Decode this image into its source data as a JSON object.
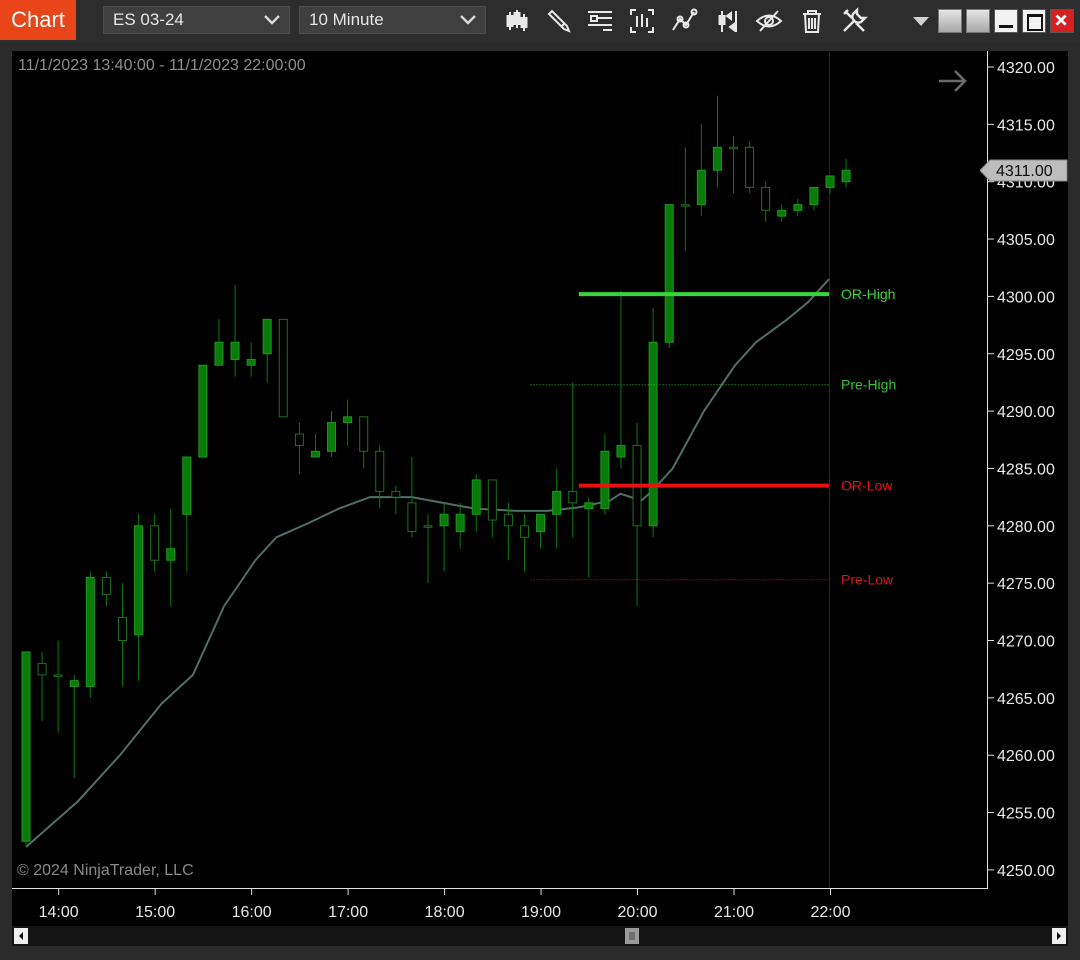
{
  "window": {
    "tab_label": "Chart",
    "instrument": "ES 03-24",
    "interval": "10 Minute"
  },
  "toolbar": {
    "icons": [
      "bar-type-icon",
      "drawing-tool-icon",
      "drawing-objects-icon",
      "data-box-icon",
      "indicators-icon",
      "strategies-icon",
      "show-hide-icon",
      "delete-icon",
      "properties-icon"
    ],
    "window_buttons": [
      "menu-dropdown-icon",
      "window-tile-1-icon",
      "window-tile-2-icon",
      "minimize-icon",
      "maximize-icon",
      "close-icon"
    ]
  },
  "chart_header": {
    "date_range": "11/1/2023 13:40:00 - 11/1/2023 22:00:00"
  },
  "footer": {
    "copyright": "© 2024 NinjaTrader, LLC"
  },
  "colors": {
    "candle_up": "#0a7a0a",
    "candle_up_body_border": "#1a9a1a",
    "candle_doji": "#1f6f1f",
    "moving_average": "#4f6f6a",
    "or_high": "#38d638",
    "or_low": "#e81010",
    "pre_high": "#38c238",
    "pre_low": "#d01818",
    "accent": "#e8461a"
  },
  "chart_data": {
    "type": "candlestick",
    "title": "",
    "xlabel": "",
    "ylabel": "",
    "ylim": [
      4248.5,
      4321.5
    ],
    "yticks": [
      "4320.00",
      "4315.00",
      "4310.00",
      "4305.00",
      "4300.00",
      "4295.00",
      "4290.00",
      "4285.00",
      "4280.00",
      "4275.00",
      "4270.00",
      "4265.00",
      "4260.00",
      "4255.00",
      "4250.00"
    ],
    "xticks": [
      "14:00",
      "15:00",
      "16:00",
      "17:00",
      "18:00",
      "19:00",
      "20:00",
      "21:00",
      "22:00"
    ],
    "last_price": "4311.00",
    "candles": [
      {
        "t": "13:40",
        "o": 4252.5,
        "h": 4269.0,
        "l": 4252.0,
        "c": 4269.0
      },
      {
        "t": "13:50",
        "o": 4268.0,
        "h": 4269.0,
        "l": 4263.0,
        "c": 4267.0
      },
      {
        "t": "14:00",
        "o": 4267.0,
        "h": 4270.0,
        "l": 4262.0,
        "c": 4267.0
      },
      {
        "t": "14:10",
        "o": 4266.0,
        "h": 4267.0,
        "l": 4258.0,
        "c": 4266.5
      },
      {
        "t": "14:20",
        "o": 4266.0,
        "h": 4276.0,
        "l": 4265.0,
        "c": 4275.5
      },
      {
        "t": "14:30",
        "o": 4275.5,
        "h": 4276.0,
        "l": 4273.0,
        "c": 4274.0
      },
      {
        "t": "14:40",
        "o": 4272.0,
        "h": 4275.0,
        "l": 4266.0,
        "c": 4270.0
      },
      {
        "t": "14:50",
        "o": 4270.5,
        "h": 4281.0,
        "l": 4266.5,
        "c": 4280.0
      },
      {
        "t": "15:00",
        "o": 4280.0,
        "h": 4281.0,
        "l": 4276.0,
        "c": 4277.0
      },
      {
        "t": "15:10",
        "o": 4277.0,
        "h": 4281.5,
        "l": 4273.0,
        "c": 4278.0
      },
      {
        "t": "15:20",
        "o": 4281.0,
        "h": 4286.0,
        "l": 4276.0,
        "c": 4286.0
      },
      {
        "t": "15:30",
        "o": 4286.0,
        "h": 4294.0,
        "l": 4286.0,
        "c": 4294.0
      },
      {
        "t": "15:40",
        "o": 4294.0,
        "h": 4298.0,
        "l": 4294.0,
        "c": 4296.0
      },
      {
        "t": "15:50",
        "o": 4294.5,
        "h": 4301.0,
        "l": 4293.0,
        "c": 4296.0
      },
      {
        "t": "16:00",
        "o": 4294.0,
        "h": 4296.0,
        "l": 4293.0,
        "c": 4294.5
      },
      {
        "t": "16:10",
        "o": 4295.0,
        "h": 4298.0,
        "l": 4292.5,
        "c": 4298.0
      },
      {
        "t": "16:20",
        "o": 4298.0,
        "h": 4298.0,
        "l": 4289.5,
        "c": 4289.5
      },
      {
        "t": "16:30",
        "o": 4288.0,
        "h": 4289.0,
        "l": 4284.5,
        "c": 4287.0
      },
      {
        "t": "16:40",
        "o": 4286.0,
        "h": 4288.0,
        "l": 4286.0,
        "c": 4286.5
      },
      {
        "t": "16:50",
        "o": 4286.5,
        "h": 4290.0,
        "l": 4286.0,
        "c": 4289.0
      },
      {
        "t": "17:00",
        "o": 4289.0,
        "h": 4291.0,
        "l": 4287.0,
        "c": 4289.5
      },
      {
        "t": "17:10",
        "o": 4289.5,
        "h": 4289.5,
        "l": 4285.0,
        "c": 4286.5
      },
      {
        "t": "17:20",
        "o": 4286.5,
        "h": 4287.0,
        "l": 4281.5,
        "c": 4283.0
      },
      {
        "t": "17:30",
        "o": 4283.0,
        "h": 4283.5,
        "l": 4281.0,
        "c": 4282.5
      },
      {
        "t": "17:40",
        "o": 4282.0,
        "h": 4286.0,
        "l": 4279.0,
        "c": 4279.5
      },
      {
        "t": "17:50",
        "o": 4280.0,
        "h": 4281.0,
        "l": 4275.0,
        "c": 4280.0
      },
      {
        "t": "18:00",
        "o": 4280.0,
        "h": 4282.0,
        "l": 4276.0,
        "c": 4281.0
      },
      {
        "t": "18:10",
        "o": 4279.5,
        "h": 4282.0,
        "l": 4278.0,
        "c": 4281.0
      },
      {
        "t": "18:20",
        "o": 4281.0,
        "h": 4284.5,
        "l": 4279.5,
        "c": 4284.0
      },
      {
        "t": "18:30",
        "o": 4284.0,
        "h": 4284.0,
        "l": 4279.0,
        "c": 4280.5
      },
      {
        "t": "18:40",
        "o": 4281.0,
        "h": 4282.0,
        "l": 4277.0,
        "c": 4280.0
      },
      {
        "t": "18:50",
        "o": 4280.0,
        "h": 4281.0,
        "l": 4276.0,
        "c": 4279.0
      },
      {
        "t": "19:00",
        "o": 4279.5,
        "h": 4281.0,
        "l": 4278.0,
        "c": 4281.0
      },
      {
        "t": "19:10",
        "o": 4281.0,
        "h": 4285.0,
        "l": 4278.0,
        "c": 4283.0
      },
      {
        "t": "19:20",
        "o": 4283.0,
        "h": 4292.5,
        "l": 4279.0,
        "c": 4282.0
      },
      {
        "t": "19:30",
        "o": 4281.5,
        "h": 4282.5,
        "l": 4275.5,
        "c": 4282.0
      },
      {
        "t": "19:40",
        "o": 4281.5,
        "h": 4288.0,
        "l": 4281.0,
        "c": 4286.5
      },
      {
        "t": "19:50",
        "o": 4286.0,
        "h": 4300.5,
        "l": 4285.0,
        "c": 4287.0
      },
      {
        "t": "20:00",
        "o": 4287.0,
        "h": 4289.0,
        "l": 4273.0,
        "c": 4280.0
      },
      {
        "t": "20:10",
        "o": 4280.0,
        "h": 4299.0,
        "l": 4279.0,
        "c": 4296.0
      },
      {
        "t": "20:20",
        "o": 4296.0,
        "h": 4308.0,
        "l": 4295.5,
        "c": 4308.0
      },
      {
        "t": "20:30",
        "o": 4308.0,
        "h": 4313.0,
        "l": 4304.0,
        "c": 4308.0
      },
      {
        "t": "20:40",
        "o": 4308.0,
        "h": 4315.0,
        "l": 4307.0,
        "c": 4311.0
      },
      {
        "t": "20:50",
        "o": 4311.0,
        "h": 4317.5,
        "l": 4309.5,
        "c": 4313.0
      },
      {
        "t": "21:00",
        "o": 4313.0,
        "h": 4314.0,
        "l": 4309.0,
        "c": 4313.0
      },
      {
        "t": "21:10",
        "o": 4313.0,
        "h": 4313.5,
        "l": 4309.0,
        "c": 4309.5
      },
      {
        "t": "21:20",
        "o": 4309.5,
        "h": 4310.0,
        "l": 4306.5,
        "c": 4307.5
      },
      {
        "t": "21:30",
        "o": 4307.0,
        "h": 4308.0,
        "l": 4306.5,
        "c": 4307.5
      },
      {
        "t": "21:40",
        "o": 4307.5,
        "h": 4308.5,
        "l": 4307.0,
        "c": 4308.0
      },
      {
        "t": "21:50",
        "o": 4308.0,
        "h": 4309.5,
        "l": 4307.5,
        "c": 4309.5
      },
      {
        "t": "22:00",
        "o": 4309.5,
        "h": 4310.5,
        "l": 4309.0,
        "c": 4310.5
      },
      {
        "t": "22:10",
        "o": 4310.0,
        "h": 4312.0,
        "l": 4309.5,
        "c": 4311.0
      }
    ],
    "moving_average": [
      [
        0,
        4252.0
      ],
      [
        5,
        4256.0
      ],
      [
        9,
        4260.0
      ],
      [
        13,
        4264.5
      ],
      [
        16,
        4267.0
      ],
      [
        19,
        4273.0
      ],
      [
        22,
        4277.0
      ],
      [
        24,
        4279.0
      ],
      [
        27,
        4280.2
      ],
      [
        30,
        4281.5
      ],
      [
        33,
        4282.5
      ],
      [
        37,
        4282.5
      ],
      [
        40,
        4282.0
      ],
      [
        43,
        4281.5
      ],
      [
        47,
        4281.3
      ],
      [
        50,
        4281.3
      ],
      [
        53,
        4281.6
      ],
      [
        56,
        4282.2
      ],
      [
        57,
        4282.8
      ],
      [
        59,
        4282.2
      ],
      [
        60,
        4283.0
      ],
      [
        62,
        4285.0
      ],
      [
        65,
        4290.0
      ],
      [
        68,
        4294.0
      ],
      [
        70,
        4296.0
      ],
      [
        73,
        4298.0
      ],
      [
        75,
        4299.5
      ],
      [
        77,
        4301.5
      ]
    ],
    "levels": [
      {
        "name": "OR-High",
        "value": 4300.2,
        "t_start": "19:30",
        "style": "solid"
      },
      {
        "name": "OR-Low",
        "value": 4283.5,
        "t_start": "19:30",
        "style": "solid"
      },
      {
        "name": "Pre-High",
        "value": 4292.3,
        "t_start": "19:00",
        "style": "dotted"
      },
      {
        "name": "Pre-Low",
        "value": 4275.3,
        "t_start": "19:00",
        "style": "dotted"
      }
    ]
  }
}
